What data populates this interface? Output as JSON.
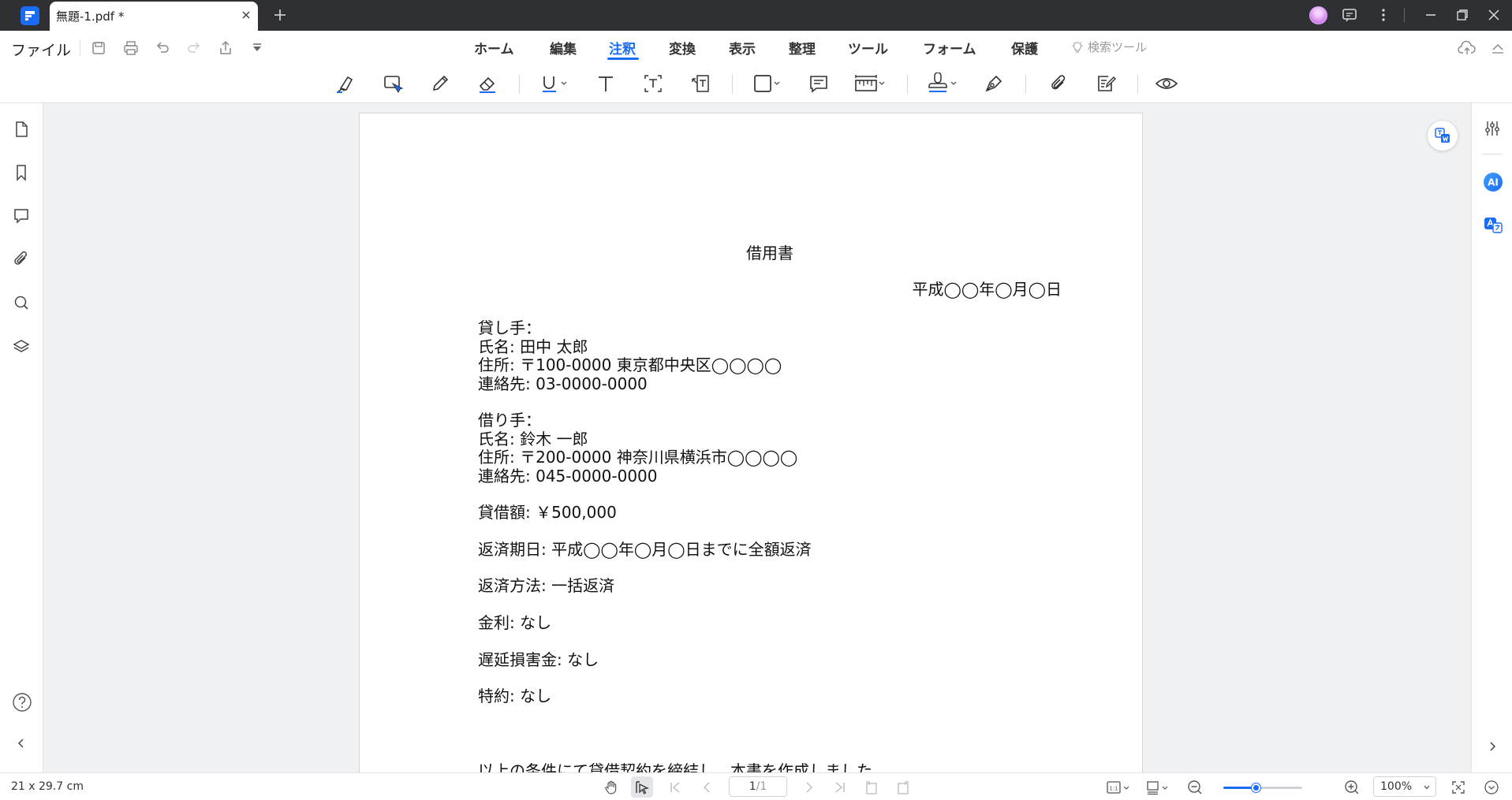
{
  "titlebar": {
    "tab_title": "無題-1.pdf *"
  },
  "menubar": {
    "file": "ファイル",
    "tabs": [
      {
        "label": "ホーム"
      },
      {
        "label": "編集"
      },
      {
        "label": "注釈"
      },
      {
        "label": "変換"
      },
      {
        "label": "表示"
      },
      {
        "label": "整理"
      },
      {
        "label": "ツール"
      },
      {
        "label": "フォーム"
      },
      {
        "label": "保護"
      }
    ],
    "active_tab": "注釈",
    "search_tools": "検索ツール"
  },
  "toolbar": {
    "tools": [
      "highlight-icon",
      "area-highlight-icon",
      "pencil-icon",
      "eraser-icon",
      "underline-icon",
      "text-icon",
      "textbox-icon",
      "callout-icon",
      "shape-icon",
      "comment-icon",
      "measure-icon",
      "stamp-icon",
      "signature-icon",
      "attachment-icon",
      "note-icon",
      "eye-icon"
    ]
  },
  "left_sidebar": [
    "page-thumbnail-icon",
    "bookmark-icon",
    "comment-icon",
    "attachment-icon",
    "search-icon",
    "layers-icon",
    "help-icon",
    "collapse-icon"
  ],
  "right_sidebar": [
    "properties-icon",
    "ai-icon",
    "translate-icon"
  ],
  "document": {
    "title": "借用書",
    "date": "平成◯◯年◯月◯日",
    "lender": {
      "heading": "貸し手：",
      "name": "氏名: 田中 太郎",
      "address": "住所: 〒100-0000 東京都中央区◯◯◯◯",
      "contact": "連絡先: 03-0000-0000"
    },
    "borrower": {
      "heading": "借り手：",
      "name": "氏名: 鈴木 一郎",
      "address": "住所: 〒200-0000 神奈川県横浜市◯◯◯◯",
      "contact": "連絡先: 045-0000-0000"
    },
    "amount": "貸借額: ￥500,000",
    "due": "返済期日: 平成◯◯年◯月◯日までに全額返済",
    "method": "返済方法: 一括返済",
    "interest": "金利: なし",
    "late_fee": "遅延損害金: なし",
    "special": "特約: なし",
    "closing": "以上の条件にて貸借契約を締結し、本書を作成しました。"
  },
  "statusbar": {
    "page_size": "21 x 29.7 cm",
    "page_current": "1",
    "page_total": "/1",
    "zoom": "100%",
    "zoom_level": 0.42
  },
  "colors": {
    "accent": "#1a6cf5",
    "titlebar": "#2f3033"
  }
}
